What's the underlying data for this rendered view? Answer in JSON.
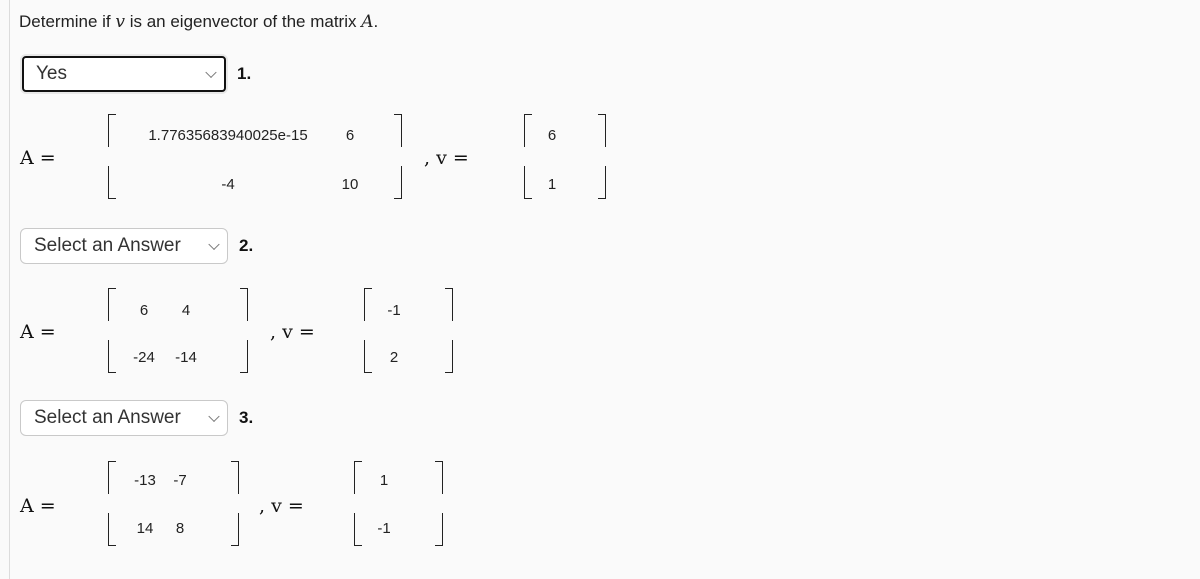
{
  "prompt": {
    "text_before": "Determine if ",
    "var_v": "v",
    "text_middle": " is an eigenvector of the matrix ",
    "var_A": "A",
    "text_after": "."
  },
  "labels": {
    "A_eq": "A =",
    "v_eq": ", v ="
  },
  "questions": [
    {
      "number": "1.",
      "select": {
        "selected": "Yes",
        "focused": true
      },
      "matrix_A": [
        [
          "1.77635683940025e-15",
          "6"
        ],
        [
          "-4",
          "10"
        ]
      ],
      "vector_v": [
        "6",
        "1"
      ]
    },
    {
      "number": "2.",
      "select": {
        "selected": "Select an Answer",
        "focused": false
      },
      "matrix_A": [
        [
          "6",
          "4"
        ],
        [
          "-24",
          "-14"
        ]
      ],
      "vector_v": [
        "-1",
        "2"
      ]
    },
    {
      "number": "3.",
      "select": {
        "selected": "Select an Answer",
        "focused": false
      },
      "matrix_A": [
        [
          "-13",
          "-7"
        ],
        [
          "14",
          "8"
        ]
      ],
      "vector_v": [
        "1",
        "-1"
      ]
    }
  ]
}
